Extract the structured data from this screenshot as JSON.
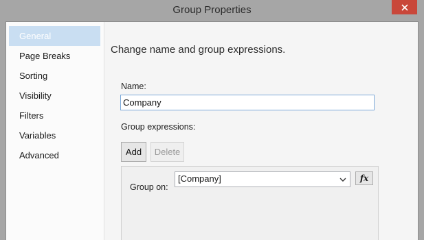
{
  "window": {
    "title": "Group Properties"
  },
  "sidebar": {
    "items": [
      {
        "label": "General",
        "active": true
      },
      {
        "label": "Page Breaks"
      },
      {
        "label": "Sorting"
      },
      {
        "label": "Visibility"
      },
      {
        "label": "Filters"
      },
      {
        "label": "Variables"
      },
      {
        "label": "Advanced"
      }
    ]
  },
  "main": {
    "heading": "Change name and group expressions.",
    "name_label": "Name:",
    "name_value": "Company",
    "group_expressions_label": "Group expressions:",
    "add_label": "Add",
    "delete_label": "Delete",
    "group_on_label": "Group on:",
    "group_on_value": "[Company]",
    "fx_label": "fx"
  },
  "colors": {
    "titlebar": "#a6a6a6",
    "close_button": "#c9473a",
    "sidebar_active": "#c9def2",
    "input_focus_border": "#7aa7d8"
  },
  "icons": {
    "close": "close-icon",
    "dropdown": "chevron-down-icon",
    "expression": "fx-icon"
  }
}
